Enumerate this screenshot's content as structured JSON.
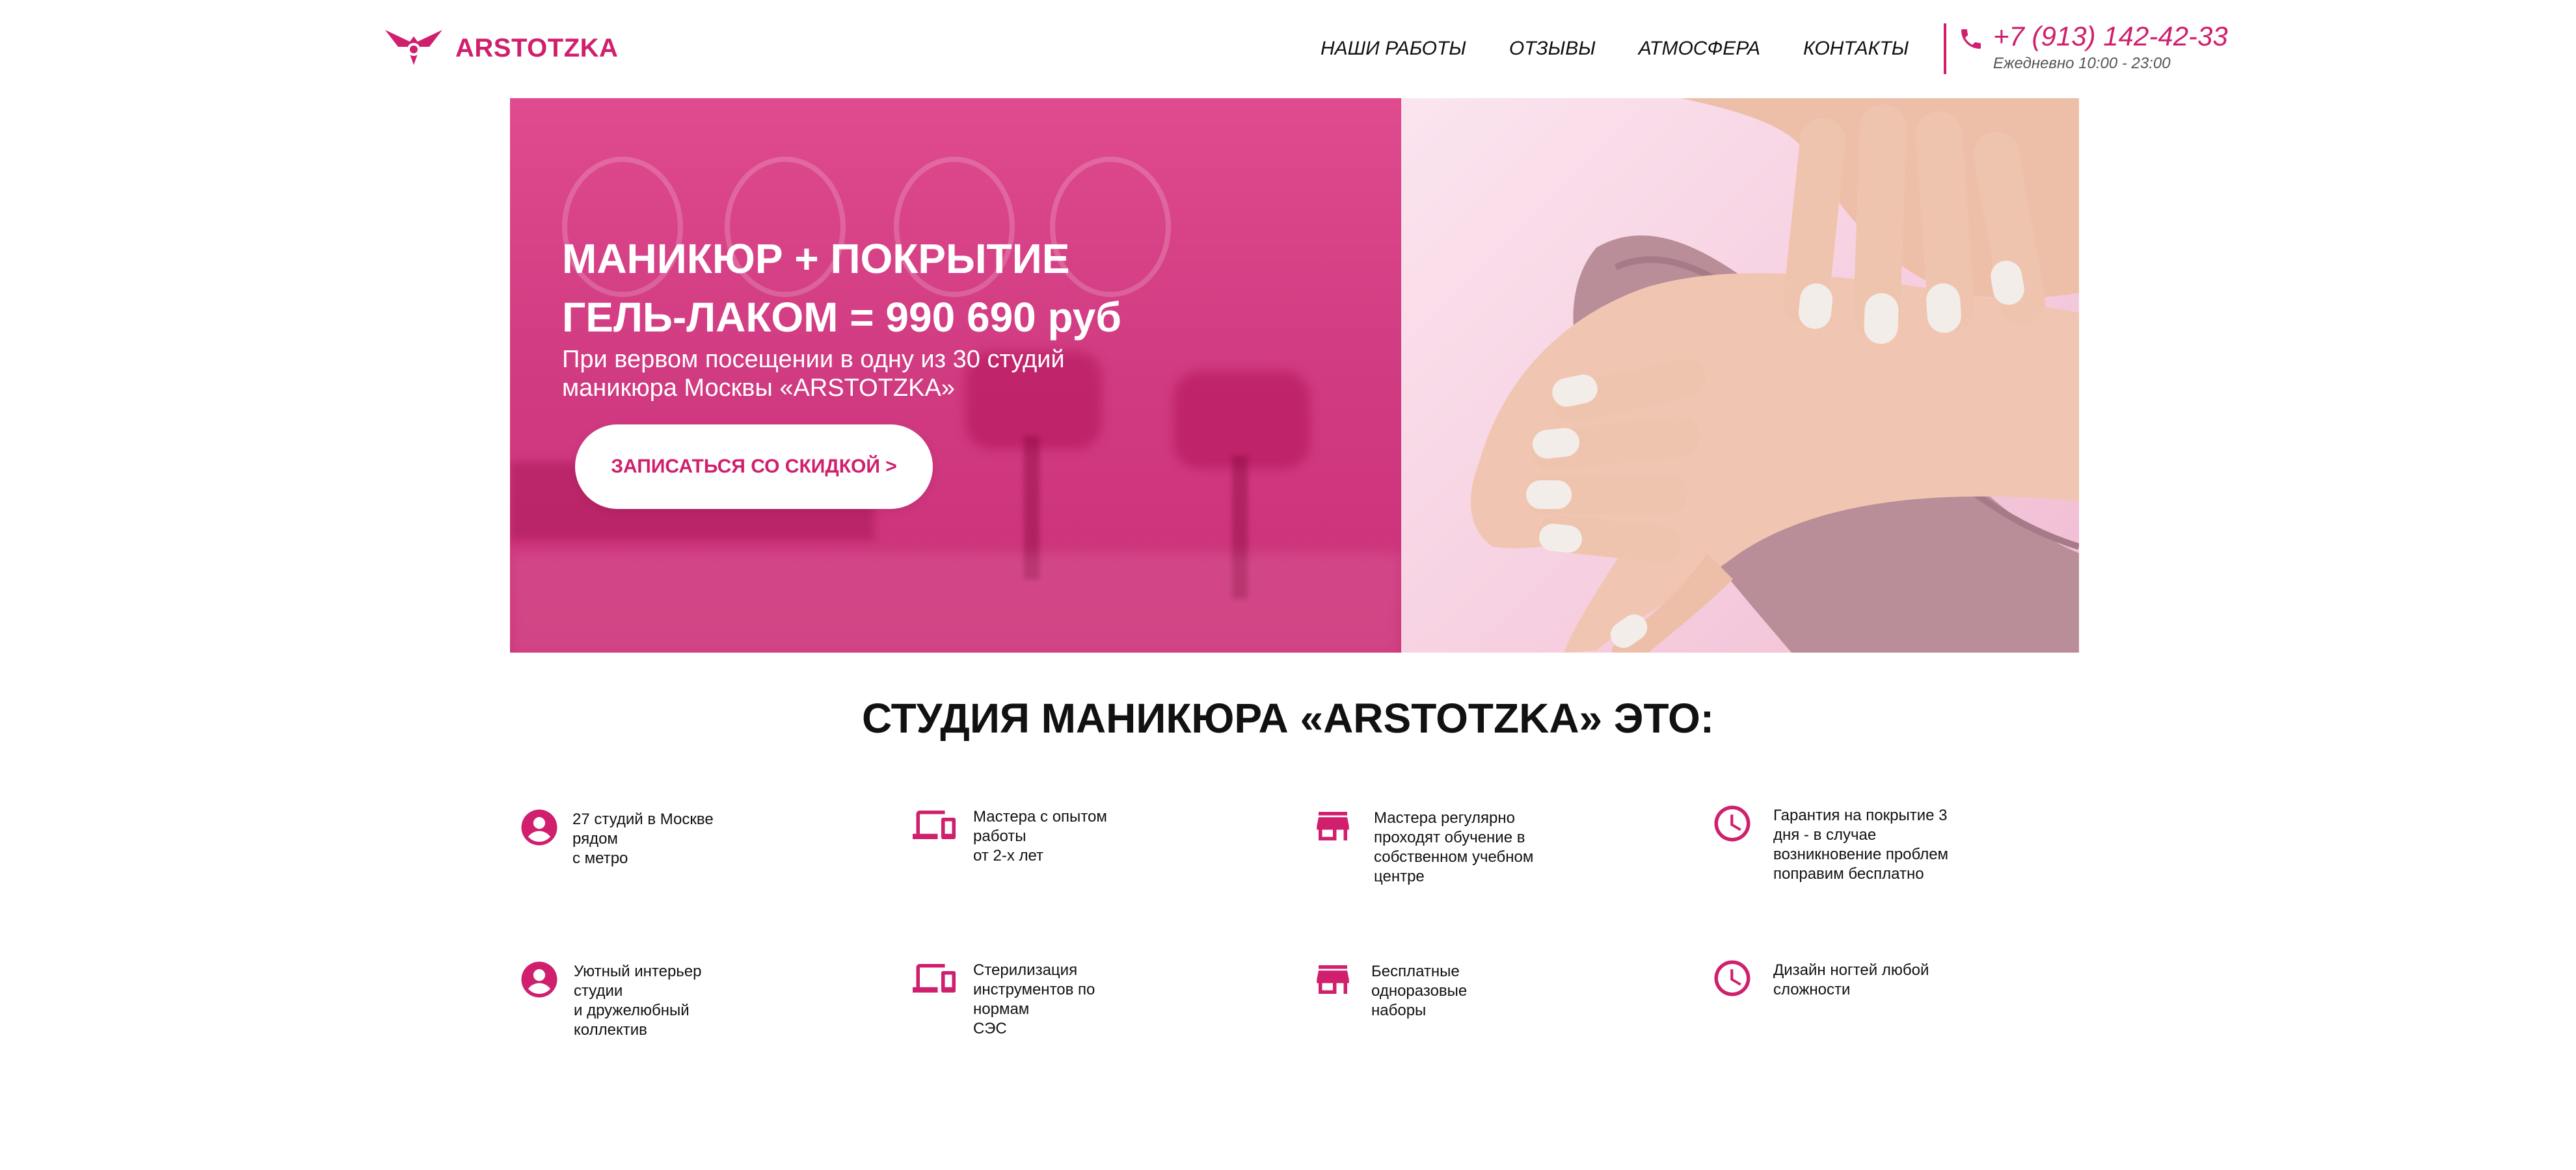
{
  "header": {
    "brand": "ARSTOTZKA",
    "nav": [
      {
        "label": "НАШИ РАБОТЫ"
      },
      {
        "label": "ОТЗЫВЫ"
      },
      {
        "label": "АТМОСФЕРА"
      },
      {
        "label": "КОНТАКТЫ"
      }
    ],
    "phone": "+7 (913) 142-42-33",
    "hours": "Ежедневно 10:00 - 23:00"
  },
  "hero": {
    "title_line1": "МАНИКЮР + ПОКРЫТИЕ",
    "title_line2": "ГЕЛЬ-ЛАКОМ = 990 690 руб",
    "subtitle_line1": "При вервом посещении в одну из 30 студий",
    "subtitle_line2": "маникюра Москвы «ARSTOTZKA»",
    "cta_label": "ЗАПИСАТЬСЯ СО СКИДКОЙ >"
  },
  "section": {
    "title": "СТУДИЯ МАНИКЮРА «ARSTOTZKA» ЭТО:",
    "features": [
      {
        "icon": "account-circle-icon",
        "text": "27 студий в Москве\nрядом\nс метро"
      },
      {
        "icon": "devices-icon",
        "text": "Мастера с опытом\nработы\nот 2-х лет"
      },
      {
        "icon": "store-icon",
        "text": "Мастера регулярно\nпроходят обучение в\nсобственном учебном\nцентре"
      },
      {
        "icon": "clock-icon",
        "text": "Гарантия на покрытие 3\nдня - в случае\nвозникновение проблем\nпоправим бесплатно"
      },
      {
        "icon": "account-circle-icon",
        "text": "Уютный интерьер\nстудии\nи дружелюбный\nколлектив"
      },
      {
        "icon": "devices-icon",
        "text": "Стерилизация\nинструментов по\nнормам\nСЭС"
      },
      {
        "icon": "store-icon",
        "text": "Бесплатные\nодноразовые\nнаборы"
      },
      {
        "icon": "clock-icon",
        "text": "Дизайн ногтей любой\nсложности"
      }
    ]
  },
  "colors": {
    "accent": "#cf1f6d",
    "text": "#111111",
    "background": "#ffffff"
  }
}
